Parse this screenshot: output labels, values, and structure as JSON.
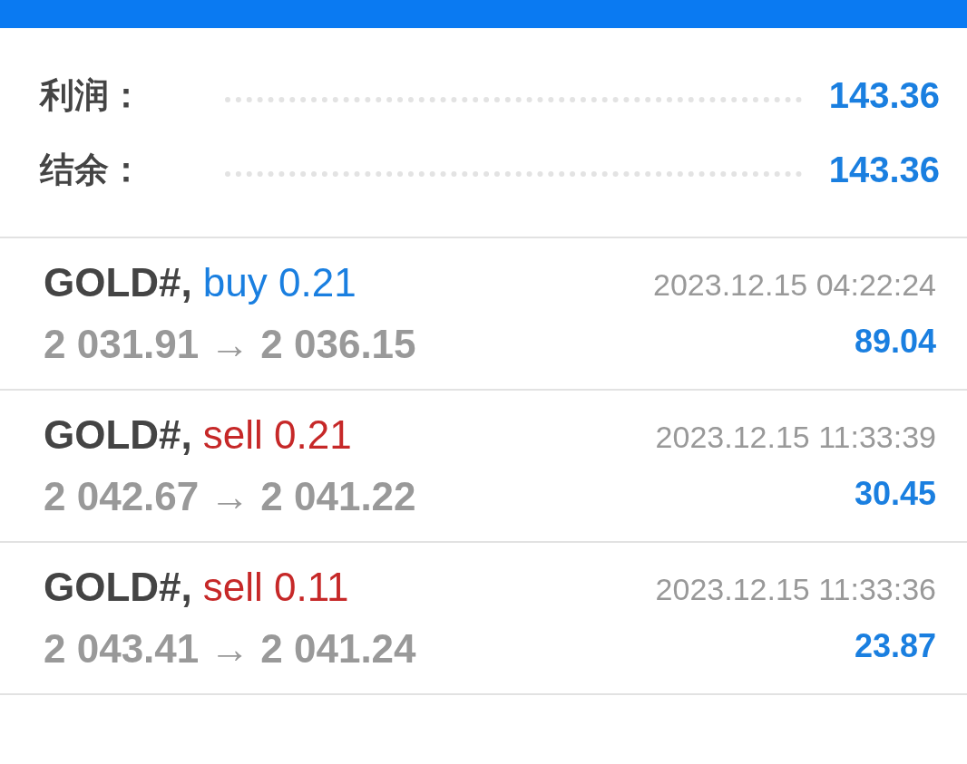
{
  "summary": [
    {
      "label": "利润：",
      "value": "143.36"
    },
    {
      "label": "结余：",
      "value": "143.36"
    }
  ],
  "trades": [
    {
      "symbol": "GOLD#,",
      "kind": "buy",
      "order": "buy 0.21",
      "open_price": "2 031.91",
      "arrow": "→",
      "close_price": "2 036.15",
      "time": "2023.12.15 04:22:24",
      "profit": "89.04"
    },
    {
      "symbol": "GOLD#,",
      "kind": "sell",
      "order": "sell 0.21",
      "open_price": "2 042.67",
      "arrow": "→",
      "close_price": "2 041.22",
      "time": "2023.12.15 11:33:39",
      "profit": "30.45"
    },
    {
      "symbol": "GOLD#,",
      "kind": "sell",
      "order": "sell 0.11",
      "open_price": "2 043.41",
      "arrow": "→",
      "close_price": "2 041.24",
      "time": "2023.12.15 11:33:36",
      "profit": "23.87"
    }
  ]
}
